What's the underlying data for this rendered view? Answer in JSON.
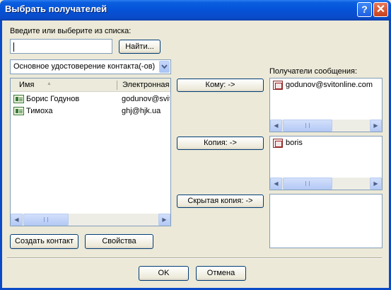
{
  "window": {
    "title": "Выбрать получателей",
    "help_glyph": "?",
    "close_glyph": "✕"
  },
  "search": {
    "label": "Введите или выберите из списка:",
    "value": "",
    "find_button": "Найти..."
  },
  "address_book": {
    "selected": "Основное удостоверение контакта(-ов)"
  },
  "contacts": {
    "columns": [
      "Имя",
      "Электронная"
    ],
    "sort_glyph": "▲",
    "rows": [
      {
        "name": "Борис Годунов",
        "email": "godunov@svit"
      },
      {
        "name": "Тимоха",
        "email": "ghj@hjk.ua"
      }
    ]
  },
  "recipients": {
    "label": "Получатели сообщения:",
    "to_button": "Кому: ->",
    "cc_button": "Копия: ->",
    "bcc_button": "Скрытая копия: ->",
    "to": [
      "godunov@svitonline.com"
    ],
    "cc": [
      "boris"
    ],
    "bcc": []
  },
  "actions": {
    "create_contact": "Создать контакт",
    "properties": "Свойства"
  },
  "footer": {
    "ok": "OK",
    "cancel": "Отмена"
  },
  "scroll_glyphs": {
    "left": "◀",
    "right": "▶",
    "down": "▼"
  },
  "colors": {
    "title_bar": "#0552d6",
    "dialog_bg": "#ece9d8",
    "close_button": "#c7401d"
  }
}
